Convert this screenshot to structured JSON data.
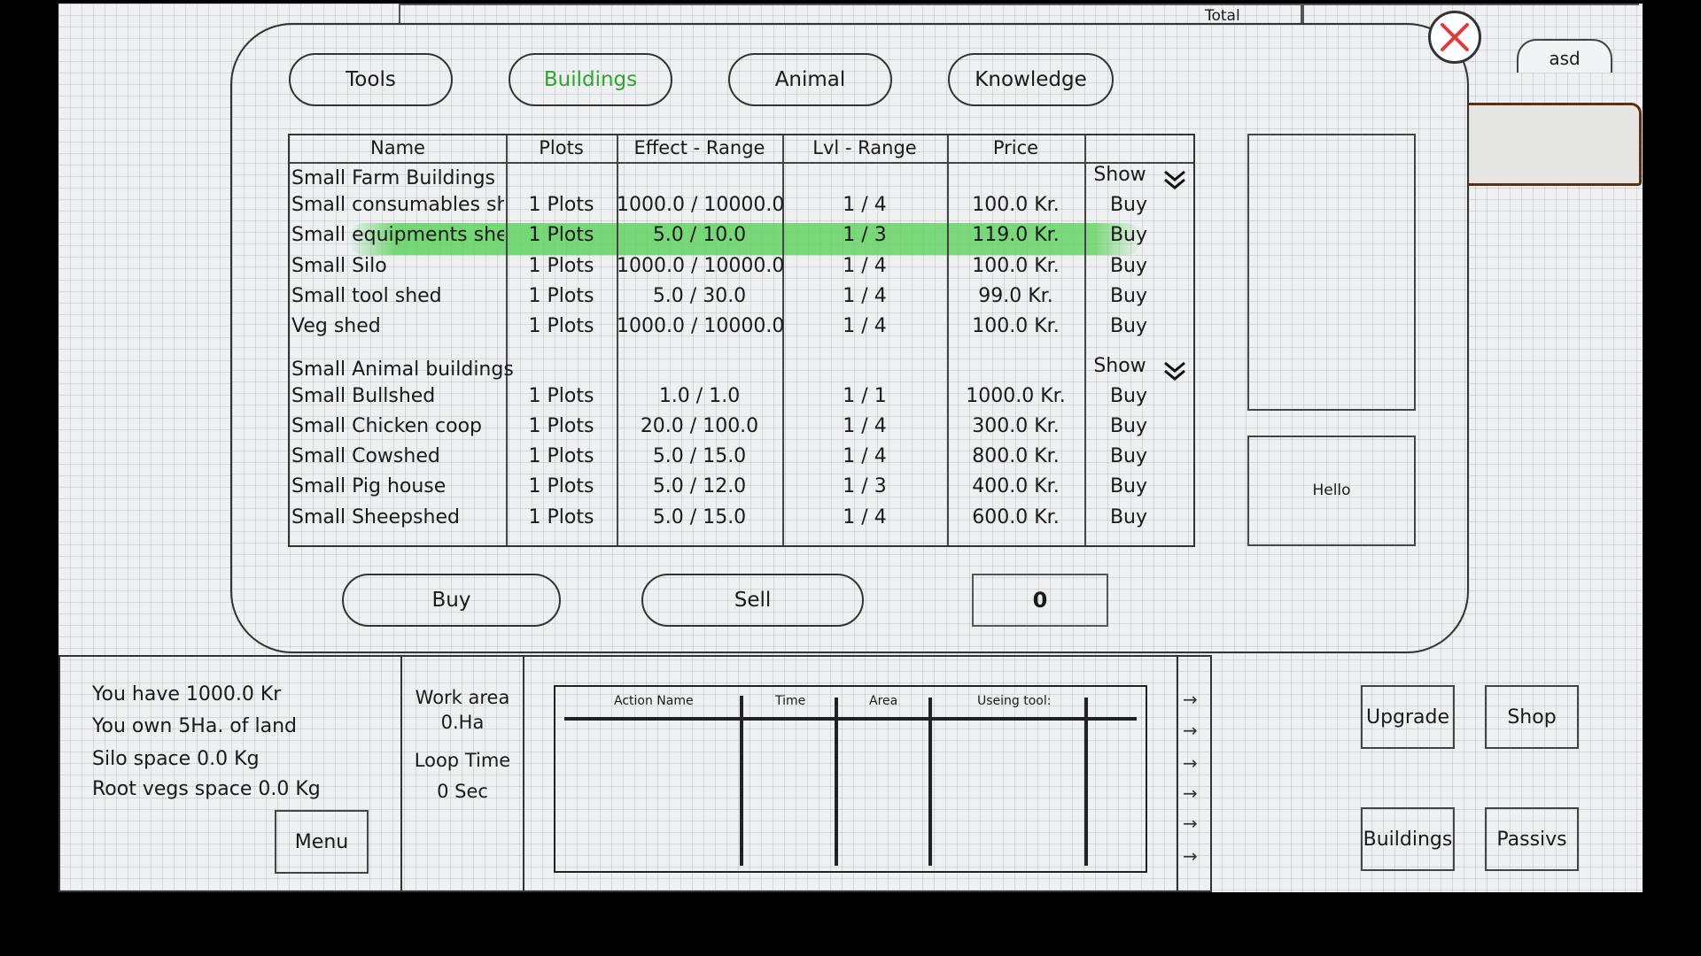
{
  "background": {
    "total_label": "Total",
    "side_tab_label": "asd"
  },
  "tabs": [
    {
      "label": "Tools",
      "active": false
    },
    {
      "label": "Buildings",
      "active": true
    },
    {
      "label": "Animal",
      "active": false
    },
    {
      "label": "Knowledge",
      "active": false
    }
  ],
  "table": {
    "headers": {
      "name": "Name",
      "plots": "Plots",
      "effect": "Effect - Range",
      "lvl": "Lvl - Range",
      "price": "Price"
    },
    "groups": [
      {
        "title": "Small  Farm Buildings",
        "show_label": "Show",
        "rows": [
          {
            "name": "Small consumables shed",
            "plots": "1 Plots",
            "effect": "1000.0 / 10000.0",
            "lvl": "1 / 4",
            "price": "100.0 Kr.",
            "action": "Buy"
          },
          {
            "name": "Small equipments shed",
            "plots": "1 Plots",
            "effect": "5.0 / 10.0",
            "lvl": "1 / 3",
            "price": "119.0 Kr.",
            "action": "Buy",
            "selected": true
          },
          {
            "name": "Small Silo",
            "plots": "1 Plots",
            "effect": "1000.0 / 10000.0",
            "lvl": "1 / 4",
            "price": "100.0 Kr.",
            "action": "Buy"
          },
          {
            "name": "Small tool shed",
            "plots": "1 Plots",
            "effect": "5.0 / 30.0",
            "lvl": "1 / 4",
            "price": "99.0 Kr.",
            "action": "Buy"
          },
          {
            "name": "Veg shed",
            "plots": "1 Plots",
            "effect": "1000.0 / 10000.0",
            "lvl": "1 / 4",
            "price": "100.0 Kr.",
            "action": "Buy"
          }
        ]
      },
      {
        "title": "Small Animal buildings",
        "show_label": "Show",
        "rows": [
          {
            "name": "Small Bullshed",
            "plots": "1 Plots",
            "effect": "1.0 / 1.0",
            "lvl": "1 / 1",
            "price": "1000.0 Kr.",
            "action": "Buy"
          },
          {
            "name": "Small Chicken coop",
            "plots": "1 Plots",
            "effect": "20.0 / 100.0",
            "lvl": "1 / 4",
            "price": "300.0 Kr.",
            "action": "Buy"
          },
          {
            "name": "Small Cowshed",
            "plots": "1 Plots",
            "effect": "5.0 / 15.0",
            "lvl": "1 / 4",
            "price": "800.0 Kr.",
            "action": "Buy"
          },
          {
            "name": "Small Pig house",
            "plots": "1 Plots",
            "effect": "5.0 / 12.0",
            "lvl": "1 / 3",
            "price": "400.0 Kr.",
            "action": "Buy"
          },
          {
            "name": "Small Sheepshed",
            "plots": "1 Plots",
            "effect": "5.0 / 15.0",
            "lvl": "1 / 4",
            "price": "600.0 Kr.",
            "action": "Buy"
          }
        ]
      }
    ]
  },
  "side": {
    "hello_text": "Hello"
  },
  "actions": {
    "buy_label": "Buy",
    "sell_label": "Sell",
    "quantity": "0"
  },
  "stats": {
    "money": "You have 1000.0 Kr",
    "land": "You own 5Ha. of land",
    "silo": "Silo space 0.0 Kg",
    "root": "Root vegs space 0.0 Kg",
    "menu_label": "Menu"
  },
  "work": {
    "area_label": "Work area",
    "area_value": "0.Ha",
    "loop_label": "Loop Time",
    "loop_value": "0 Sec"
  },
  "action_table": {
    "headers": [
      "Action Name",
      "Time",
      "Area",
      "Useing tool:"
    ]
  },
  "nav_buttons": {
    "upgrade": "Upgrade",
    "shop": "Shop",
    "buildings": "Buildings",
    "passivs": "Passivs"
  },
  "colors": {
    "active_tab": "#2ea62e",
    "highlight": "#60d260",
    "close_icon": "#e03a3a"
  }
}
